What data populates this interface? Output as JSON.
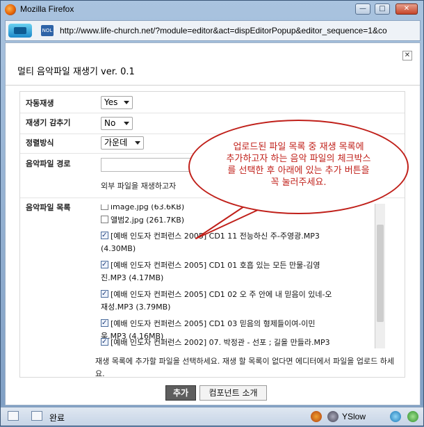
{
  "window": {
    "title": "Mozilla Firefox",
    "min_glyph": "—",
    "max_glyph": "□",
    "close_glyph": "✕"
  },
  "address": {
    "url": "http://www.life-church.net/?module=editor&act=dispEditorPopup&editor_sequence=1&co"
  },
  "popup": {
    "close_glyph": "✕",
    "title": "멀티 음악파일 재생기 ver. 0.1",
    "fields": {
      "autoplay": {
        "label": "자동재생",
        "value": "Yes"
      },
      "hide_player": {
        "label": "재생기 감추기",
        "value": "No"
      },
      "align": {
        "label": "정렬방식",
        "value": "가운데"
      },
      "path": {
        "label": "음악파일 경로",
        "help": "외부 파일을 재생하고자"
      },
      "list": {
        "label": "음악파일 목록"
      }
    },
    "files": [
      {
        "name": "image.jpg (63.6KB)",
        "checked": false
      },
      {
        "name": "앨범2.jpg (261.7KB)",
        "checked": false
      },
      {
        "line1": "[예배 인도자 컨퍼런스 2005] CD1 11 전능하신 주-주영광.MP3",
        "line2": "(4.30MB)",
        "checked": true
      },
      {
        "line1": "[예배 인도자 컨퍼런스 2005] CD1 01 호흡 있는 모든 만물-김영",
        "line2": "진.MP3 (4.17MB)",
        "checked": true
      },
      {
        "line1": "[예배 인도자 컨퍼런스 2005] CD1 02 오 주 안에 내 믿음이 있네-오",
        "line2": "재성.MP3 (3.79MB)",
        "checked": true
      },
      {
        "line1": "[예배 인도자 컨퍼런스 2005] CD1 03 믿음의 형제들이여-이민",
        "line2": "욱.MP3 (4.16MB)",
        "checked": true
      },
      {
        "line1": "[예배 인도자 컨퍼런스 2002] 07. 박정관 - 선포 ; 길을 만들라.MP3",
        "checked": true
      }
    ],
    "instruction": "재생 목록에 추가할 파일을 선택하세요. 재생 할 목록이 없다면 에디터에서 파일을 업로드 하세요.",
    "buttons": {
      "add": "추가",
      "about": "컴포넌트 소개"
    }
  },
  "callout": {
    "lines": [
      "업로드된 파일 목록 중 재생 목록에",
      "추가하고자 하는 음악 파일의 체크박스",
      "를 선택한 후 아래에 있는 추가 버튼을",
      "꼭 눌러주세요."
    ],
    "color": "#c0201a"
  },
  "statusbar": {
    "status": "완료",
    "yslow": "YSlow"
  }
}
